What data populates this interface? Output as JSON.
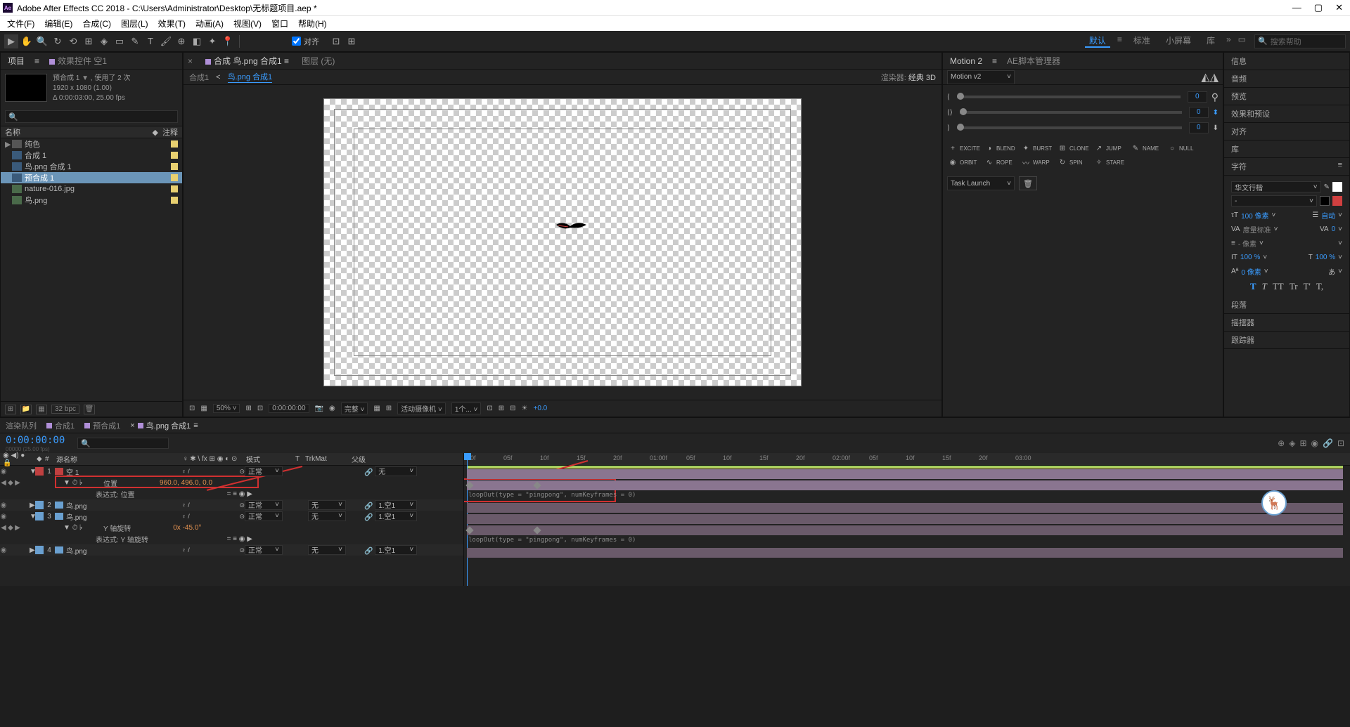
{
  "titlebar": {
    "app_badge": "Ae",
    "title": "Adobe After Effects CC 2018 - C:\\Users\\Administrator\\Desktop\\无标题项目.aep *"
  },
  "menubar": [
    "文件(F)",
    "编辑(E)",
    "合成(C)",
    "图层(L)",
    "效果(T)",
    "动画(A)",
    "视图(V)",
    "窗口",
    "帮助(H)"
  ],
  "toolbar": {
    "snap_label": "对齐"
  },
  "workspaces": {
    "items": [
      "默认",
      "标准",
      "小屏幕",
      "库"
    ],
    "active": 0,
    "search_placeholder": "搜索帮助"
  },
  "project_panel": {
    "tabs": [
      "项目",
      "效果控件 空1"
    ],
    "comp_info": {
      "name": "预合成 1",
      "used": "使用了 2 次",
      "res": "1920 x 1080 (1.00)",
      "dur": "Δ 0:00:03:00, 25.00 fps"
    },
    "search_placeholder": "",
    "columns": {
      "name": "名称",
      "tag": "注释"
    },
    "items": [
      {
        "type": "folder",
        "name": "纯色",
        "depth": 0,
        "tw": "▶"
      },
      {
        "type": "comp",
        "name": "合成 1",
        "depth": 0
      },
      {
        "type": "comp",
        "name": "鸟.png 合成 1",
        "depth": 0
      },
      {
        "type": "comp",
        "name": "预合成 1",
        "depth": 0,
        "selected": true
      },
      {
        "type": "img",
        "name": "nature-016.jpg",
        "depth": 0
      },
      {
        "type": "img",
        "name": "鸟.png",
        "depth": 0
      }
    ],
    "footer_bpc": "32 bpc"
  },
  "viewer": {
    "tabs": [
      "合成 鸟.png 合成1",
      "图层 (无)"
    ],
    "breadcrumb": [
      "合成1",
      "鸟.png 合成1"
    ],
    "renderer_label": "渲染器:",
    "renderer_value": "经典 3D",
    "footer": {
      "zoom": "50%",
      "time": "0:00:00:00",
      "res": "完整",
      "camera": "活动摄像机",
      "views": "1个...",
      "exposure": "+0.0"
    }
  },
  "motion": {
    "tabs": [
      "Motion 2",
      "AE脚本管理器"
    ],
    "dropdown": "Motion v2",
    "values": [
      "0",
      "0",
      "0"
    ],
    "tools": [
      {
        "icon": "+",
        "label": "EXCITE"
      },
      {
        "icon": "◑",
        "label": "BLEND"
      },
      {
        "icon": "✦",
        "label": "BURST"
      },
      {
        "icon": "⊞",
        "label": "CLONE"
      },
      {
        "icon": "↗",
        "label": "JUMP"
      },
      {
        "icon": "✎",
        "label": "NAME"
      },
      {
        "icon": "○",
        "label": "NULL"
      },
      {
        "icon": "◉",
        "label": "ORBIT"
      },
      {
        "icon": "∿",
        "label": "ROPE"
      },
      {
        "icon": "〰",
        "label": "WARP"
      },
      {
        "icon": "↻",
        "label": "SPIN"
      },
      {
        "icon": "✧",
        "label": "STARE"
      }
    ],
    "task": "Task Launch"
  },
  "right_panels": [
    "信息",
    "音频",
    "预览",
    "效果和预设",
    "对齐",
    "库",
    "字符"
  ],
  "character": {
    "font": "华文行楷",
    "style": "-",
    "size": "100 像素",
    "leading": "自动",
    "kerning": "度量标准",
    "tracking": "0",
    "scale": "- 像素",
    "vscale": "100 %",
    "hscale": "100 %",
    "baseline": "0 像素",
    "styles": [
      "T",
      "T",
      "TT",
      "Tr",
      "T'",
      "T,"
    ]
  },
  "right_panels2": [
    "段落",
    "摇摆器",
    "跟踪器"
  ],
  "timeline": {
    "tabs": [
      "渲染队列",
      "合成1",
      "预合成1",
      "鸟.png 合成1"
    ],
    "active_tab": 3,
    "timecode": "0:00:00:00",
    "frame_info": "00000 (25.00 fps)",
    "columns": {
      "source": "源名称",
      "switches": "♀ ✱ \\ fx ⊞ ◉ ◐ ⊙",
      "mode": "模式",
      "trkmat_t": "T",
      "trkmat": "TrkMat",
      "parent": "父级"
    },
    "layers": [
      {
        "num": "1",
        "name": "空 1",
        "color": "#c04040",
        "switches": "♀  /",
        "threeD": "⊙",
        "mode": "正常",
        "trkmat": "",
        "parent": "无",
        "expanded": true,
        "props": [
          {
            "name": "位置",
            "value": "960.0, 496.0, 0.0",
            "stopwatch": true,
            "highlight": true
          },
          {
            "name": "表达式: 位置",
            "expr_switches": true
          }
        ]
      },
      {
        "num": "2",
        "name": "鸟.png",
        "color": "#6aa0d0",
        "switches": "♀  /",
        "threeD": "⊙",
        "mode": "正常",
        "trkmat": "无",
        "parent": "1.空1"
      },
      {
        "num": "3",
        "name": "鸟.png",
        "color": "#6aa0d0",
        "switches": "♀  /",
        "threeD": "⊙",
        "mode": "正常",
        "trkmat": "无",
        "parent": "1.空1",
        "expanded": true,
        "props": [
          {
            "name": "Y 轴旋转",
            "value": "0x -45.0°",
            "stopwatch": true
          },
          {
            "name": "表达式: Y 轴旋转",
            "expr_switches": true
          }
        ]
      },
      {
        "num": "4",
        "name": "鸟.png",
        "color": "#6aa0d0",
        "switches": "♀  /",
        "threeD": "⊙",
        "mode": "正常",
        "trkmat": "无",
        "parent": "1.空1"
      }
    ],
    "ruler_ticks": [
      "00f",
      "05f",
      "10f",
      "15f",
      "20f",
      "01:00f",
      "05f",
      "10f",
      "15f",
      "20f",
      "02:00f",
      "05f",
      "10f",
      "15f",
      "20f",
      "03:00"
    ],
    "expression_text": "loopOut(type = \"pingpong\", numKeyframes = 0)"
  }
}
